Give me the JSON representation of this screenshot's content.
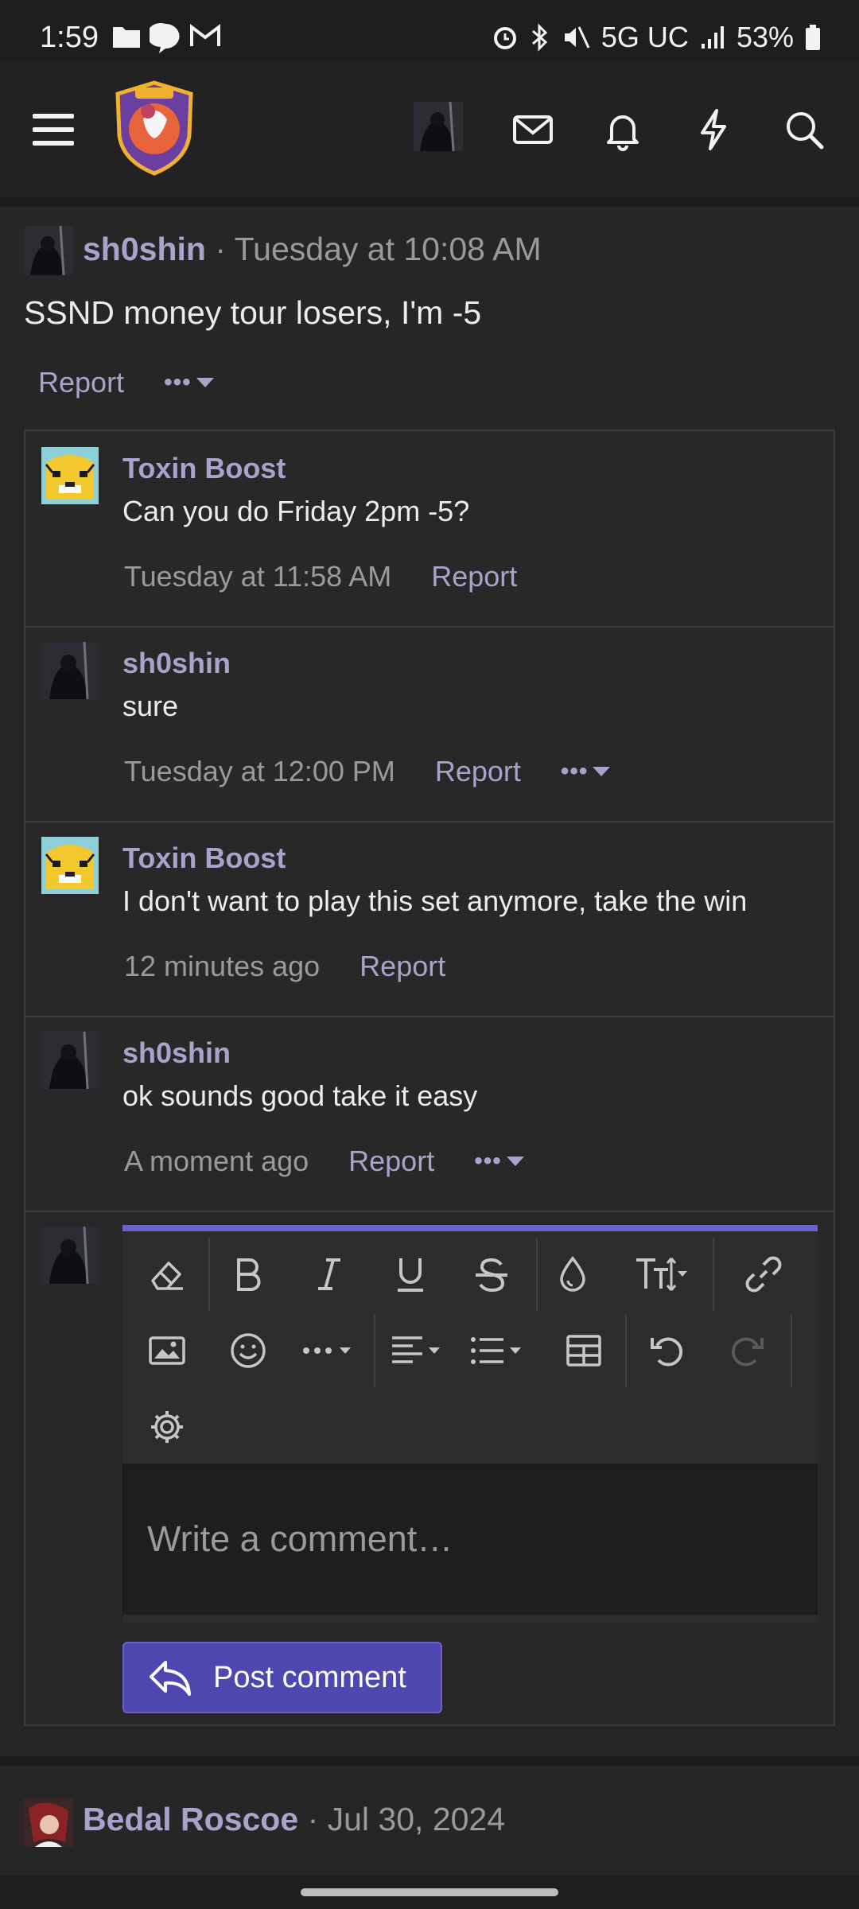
{
  "status_bar": {
    "time": "1:59",
    "network": "5G UC",
    "battery": "53%"
  },
  "nav": {
    "icons": [
      "menu-icon",
      "site-logo",
      "user-avatar",
      "mail-icon",
      "bell-icon",
      "bolt-icon",
      "search-icon"
    ]
  },
  "post": {
    "username": "sh0shin",
    "separator": "·",
    "time": "Tuesday at 10:08 AM",
    "text": "SSND money tour losers, I'm -5",
    "report_label": "Report",
    "more_label": "•••"
  },
  "comments": [
    {
      "username": "Toxin Boost",
      "text": "Can you do Friday 2pm -5?",
      "time": "Tuesday at 11:58 AM",
      "report": "Report",
      "has_more": false
    },
    {
      "username": "sh0shin",
      "text": "sure",
      "time": "Tuesday at 12:00 PM",
      "report": "Report",
      "has_more": true
    },
    {
      "username": "Toxin Boost",
      "text": "I don't want to play this set anymore, take the win",
      "time": "12 minutes ago",
      "report": "Report",
      "has_more": false
    },
    {
      "username": "sh0shin",
      "text": "ok sounds good take it easy",
      "time": "A moment ago",
      "report": "Report",
      "has_more": true
    }
  ],
  "editor": {
    "placeholder": "Write a comment…",
    "post_button": "Post comment",
    "accent": "#6a61c9",
    "button_color": "#4e47b0"
  },
  "next_post": {
    "username": "Bedal Roscoe",
    "separator": "·",
    "time": "Jul 30, 2024"
  },
  "colors": {
    "background": "#262626",
    "link": "#a9a3cc",
    "muted": "#9a9a9a"
  }
}
